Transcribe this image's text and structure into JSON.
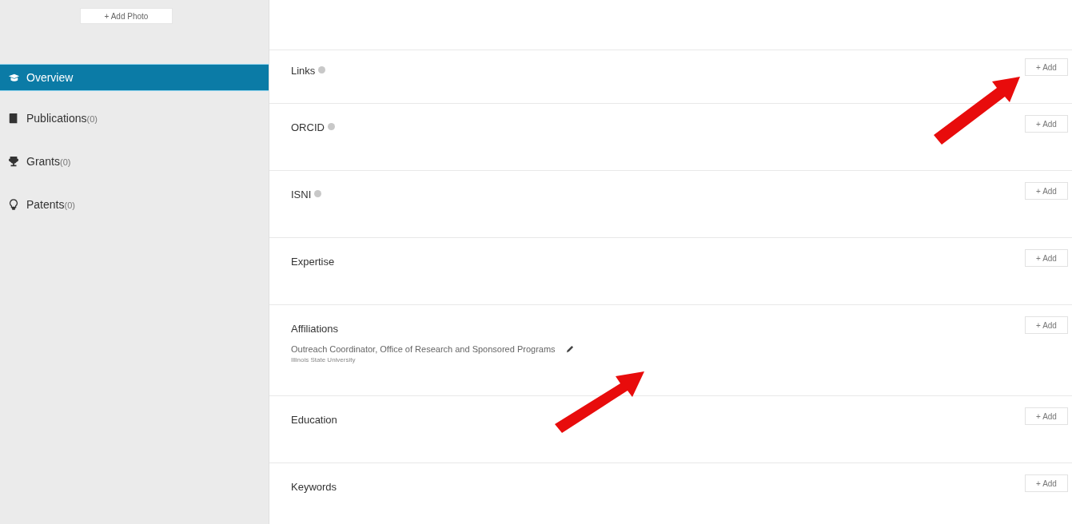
{
  "sidebar": {
    "add_photo_button": "+ Add Photo",
    "items": [
      {
        "label": "Overview",
        "selected": true
      },
      {
        "label": "Publications",
        "count": "(0)",
        "selected": false
      },
      {
        "label": "Grants",
        "count": "(0)",
        "selected": false
      },
      {
        "label": "Patents",
        "count": "(0)",
        "selected": false
      }
    ]
  },
  "sections": [
    {
      "title": "Links",
      "help": true,
      "add_button": "+ Add"
    },
    {
      "title": "ORCID",
      "help": true,
      "add_button": "+ Add"
    },
    {
      "title": "ISNI",
      "help": true,
      "add_button": "+ Add"
    },
    {
      "title": "Expertise",
      "help": false,
      "add_button": "+ Add"
    },
    {
      "title": "Affiliations",
      "help": false,
      "add_button": "+ Add",
      "entries": [
        {
          "position": "Outreach Coordinator, Office of Research and Sponsored Programs",
          "organization": "Illinois State University",
          "editable": true
        }
      ]
    },
    {
      "title": "Education",
      "help": false,
      "add_button": "+ Add"
    },
    {
      "title": "Keywords",
      "help": false,
      "add_button": "+ Add"
    }
  ]
}
